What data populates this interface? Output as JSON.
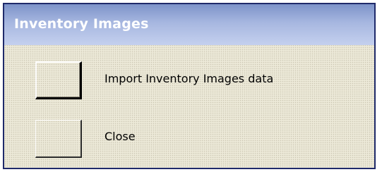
{
  "window": {
    "title": "Inventory Images"
  },
  "commands": [
    {
      "label": "Import Inventory Images data"
    },
    {
      "label": "Close"
    }
  ],
  "colors": {
    "titlebar_start": "#7d93c9",
    "titlebar_end": "#c4d0ee",
    "background": "#ece9d8",
    "border": "#1f2a6a"
  }
}
